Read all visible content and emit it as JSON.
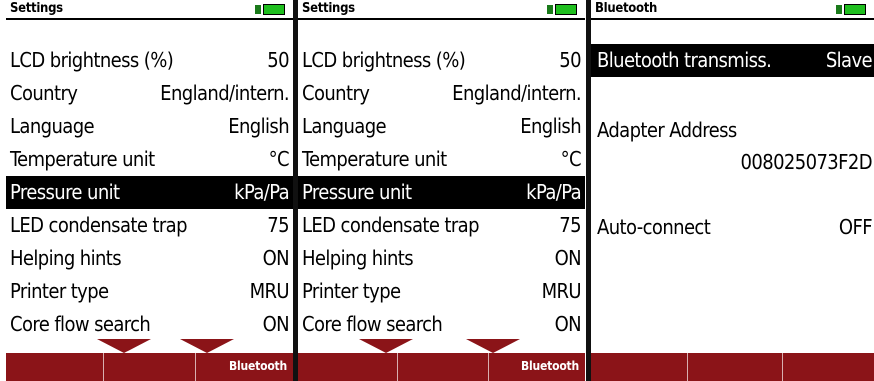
{
  "screens": [
    {
      "title": "Settings",
      "rows": [
        {
          "label": "LCD brightness (%)",
          "value": "50"
        },
        {
          "label": "Country",
          "value": "England/intern."
        },
        {
          "label": "Language",
          "value": "English"
        },
        {
          "label": "Temperature unit",
          "value": "°C"
        },
        {
          "label": "Pressure unit",
          "value": "kPa/Pa",
          "selected": true
        },
        {
          "label": "LED condensate trap",
          "value": "75"
        },
        {
          "label": "Helping hints",
          "value": "ON"
        },
        {
          "label": "Printer type",
          "value": "MRU"
        },
        {
          "label": "Core flow search",
          "value": "ON"
        }
      ],
      "softkey": "Bluetooth"
    },
    {
      "title": "Settings",
      "rows": [
        {
          "label": "LCD brightness (%)",
          "value": "50"
        },
        {
          "label": "Country",
          "value": "England/intern."
        },
        {
          "label": "Language",
          "value": "English"
        },
        {
          "label": "Temperature unit",
          "value": "°C"
        },
        {
          "label": "Pressure unit",
          "value": "kPa/Pa",
          "selected": true
        },
        {
          "label": "LED condensate trap",
          "value": "75"
        },
        {
          "label": "Helping hints",
          "value": "ON"
        },
        {
          "label": "Printer type",
          "value": "MRU"
        },
        {
          "label": "Core flow search",
          "value": "ON"
        }
      ],
      "softkey": "Bluetooth"
    },
    {
      "title": "Bluetooth",
      "transmission_label": "Bluetooth transmiss.",
      "transmission_value": "Slave",
      "adapter_label": "Adapter Address",
      "adapter_value": "008025073F2D",
      "autoconnect_label": "Auto-connect",
      "autoconnect_value": "OFF"
    }
  ],
  "colors": {
    "softkey_bar": "#8b1418",
    "battery": "#1fbf1f",
    "selection": "#000000"
  }
}
